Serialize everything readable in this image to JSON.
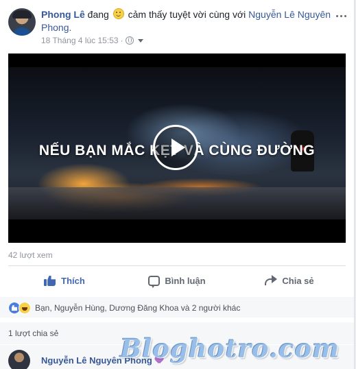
{
  "post": {
    "author": "Phong Lê",
    "status_prefix": "đang",
    "feeling": "cảm thấy tuyệt vời cùng với",
    "tagged": "Nguyễn Lê Nguyên Phong.",
    "timestamp": "18 Tháng 4 lúc 15:53",
    "privacy_icon": "globe-icon",
    "menu_icon": "more-icon"
  },
  "video": {
    "overlay_text": "NẾU BẠN MẮC KẸT VÀ CÙNG ĐƯỜNG",
    "play_icon": "play-icon",
    "views": "42 lượt xem"
  },
  "actions": {
    "like": "Thích",
    "comment": "Bình luận",
    "share": "Chia sẻ"
  },
  "reactions": {
    "summary": "Bạn, Nguyễn Hùng, Dương Đăng Khoa và 2 người khác"
  },
  "shares": {
    "count": "1 lượt chia sẻ"
  },
  "comment": {
    "commenter": "Nguyễn Lê Nguyên Phong"
  },
  "watermark": {
    "text": "Bloghotro.com"
  },
  "colors": {
    "link": "#365899",
    "like_blue": "#4267b2",
    "muted": "#90949c"
  }
}
